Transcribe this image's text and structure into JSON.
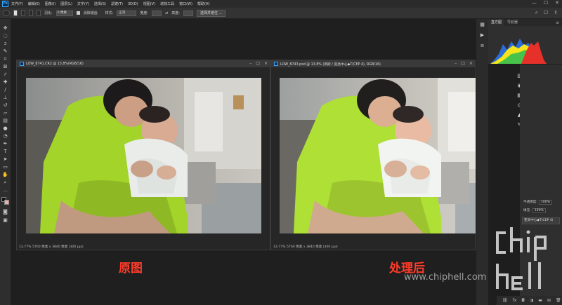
{
  "menubar": {
    "logo": "Ps",
    "items": [
      "文件(F)",
      "编辑(E)",
      "图像(I)",
      "图层(L)",
      "文字(Y)",
      "选择(S)",
      "滤镜(T)",
      "3D(D)",
      "视图(V)",
      "增效工具",
      "窗口(W)",
      "帮助(H)"
    ],
    "window_controls": [
      "—",
      "☐",
      "✕"
    ]
  },
  "options": {
    "feather_label": "羽化:",
    "feather_value": "0 像素",
    "antialias_label": "消除锯齿",
    "style_label": "样式:",
    "style_value": "正常",
    "width_label": "宽度:",
    "height_label": "高度:",
    "select_mask_button": "选择并遮住 ...",
    "right_icons": [
      "⌕",
      "☐",
      "⇪"
    ]
  },
  "documents": [
    {
      "title": "LOW_8741.CR2 @ 13.8%(RGB/16)",
      "status": "13.77%    5760 像素 x 3840 像素 (300 ppi)",
      "caption": "原图"
    },
    {
      "title": "LOW_8743.psd @ 13.8% (高斯 / 变亮中心◆T(CEP 4), RGB/16)",
      "status": "13.77%    5760 像素 x 3840 像素 (300 ppi)",
      "caption": "处理后"
    }
  ],
  "histogram_panel": {
    "tabs": [
      "直方图",
      "导航器"
    ]
  },
  "layers_panel": {
    "opacity_label": "不透明度:",
    "opacity_value": "100%",
    "fill_label": "填充:",
    "fill_value": "100%",
    "selected_layer": "变亮中心◆T(CEP 4)"
  },
  "watermark": {
    "url": "www.chiphell.com",
    "logo_text": "chiphell"
  },
  "colors": {
    "accent_blue": "#31a8ff",
    "caption_red": "#ff3b2a"
  }
}
